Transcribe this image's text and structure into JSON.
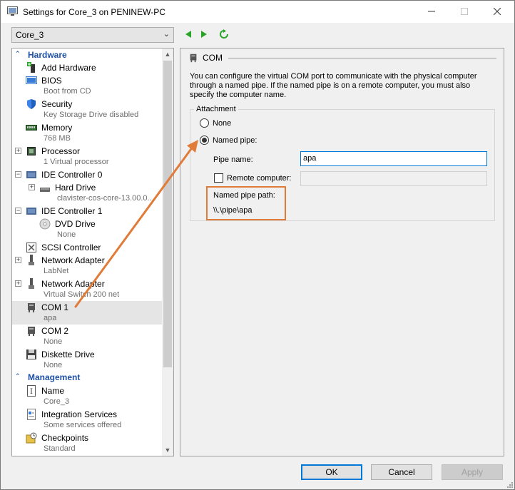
{
  "window": {
    "title": "Settings for Core_3 on PENINEW-PC"
  },
  "toolbar": {
    "vm_selected": "Core_3"
  },
  "tree": {
    "hardware_header": "Hardware",
    "management_header": "Management",
    "items": [
      {
        "label": "Add Hardware",
        "sub": ""
      },
      {
        "label": "BIOS",
        "sub": "Boot from CD"
      },
      {
        "label": "Security",
        "sub": "Key Storage Drive disabled"
      },
      {
        "label": "Memory",
        "sub": "768 MB"
      },
      {
        "label": "Processor",
        "sub": "1 Virtual processor"
      },
      {
        "label": "IDE Controller 0",
        "sub": ""
      },
      {
        "label": "Hard Drive",
        "sub": "clavister-cos-core-13.00.0..."
      },
      {
        "label": "IDE Controller 1",
        "sub": ""
      },
      {
        "label": "DVD Drive",
        "sub": "None"
      },
      {
        "label": "SCSI Controller",
        "sub": ""
      },
      {
        "label": "Network Adapter",
        "sub": "LabNet"
      },
      {
        "label": "Network Adapter",
        "sub": "Virtual Switch 200 net"
      },
      {
        "label": "COM 1",
        "sub": "apa"
      },
      {
        "label": "COM 2",
        "sub": "None"
      },
      {
        "label": "Diskette Drive",
        "sub": "None"
      }
    ],
    "management_items": [
      {
        "label": "Name",
        "sub": "Core_3"
      },
      {
        "label": "Integration Services",
        "sub": "Some services offered"
      },
      {
        "label": "Checkpoints",
        "sub": "Standard"
      }
    ]
  },
  "com": {
    "header": "COM",
    "description": "You can configure the virtual COM port to communicate with the physical computer through a named pipe. If the named pipe is on a remote computer, you must also specify the computer name.",
    "attachment_label": "Attachment",
    "none_label": "None",
    "named_pipe_label": "Named pipe:",
    "pipe_name_label": "Pipe name:",
    "pipe_name_value": "apa",
    "remote_computer_label": "Remote computer:",
    "remote_computer_value": "",
    "named_pipe_path_label": "Named pipe path:",
    "named_pipe_path_value": "\\\\.\\pipe\\apa"
  },
  "buttons": {
    "ok": "OK",
    "cancel": "Cancel",
    "apply": "Apply"
  },
  "colors": {
    "accent": "#0078d7",
    "section_header": "#1d4fa3",
    "annotation": "#e07b39",
    "nav_green": "#2aa52a"
  }
}
